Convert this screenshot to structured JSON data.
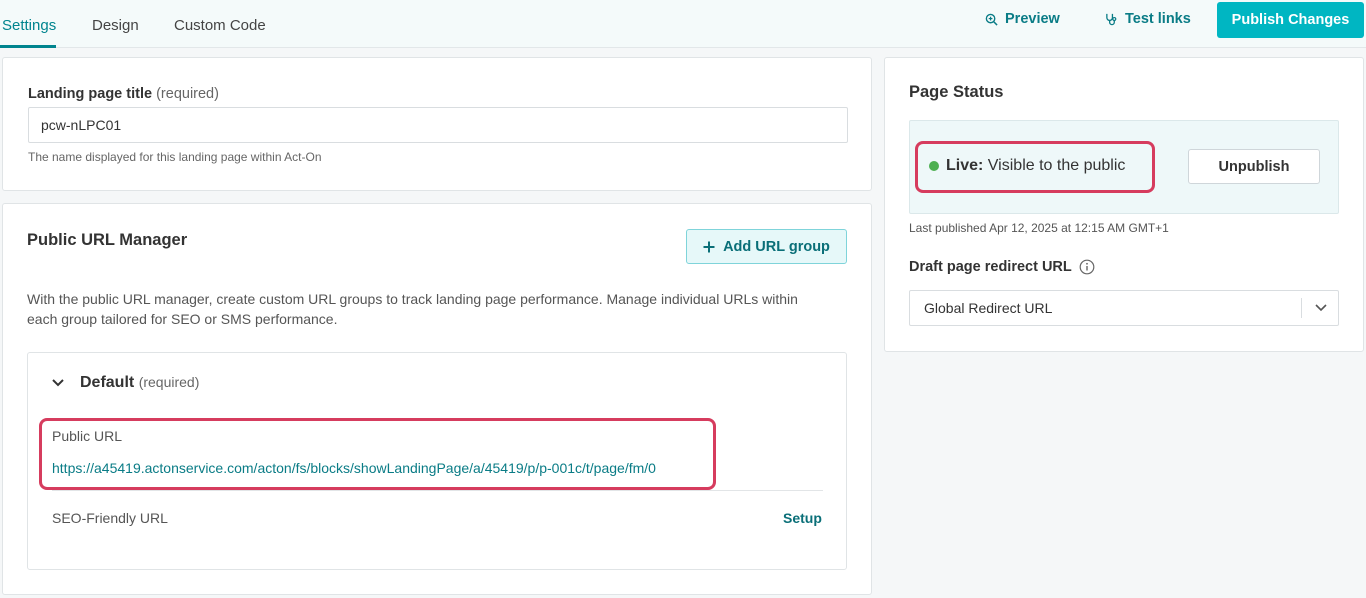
{
  "tabs": [
    {
      "label": "Settings"
    },
    {
      "label": "Design"
    },
    {
      "label": "Custom Code"
    }
  ],
  "toolbar": {
    "preview_label": "Preview",
    "test_links_label": "Test links",
    "publish_label": "Publish Changes"
  },
  "title_card": {
    "label": "Landing page title",
    "required": "(required)",
    "value": "pcw-nLPC01",
    "helper": "The name displayed for this landing page within Act-On"
  },
  "url_manager": {
    "title": "Public URL Manager",
    "add_group_label": "Add URL group",
    "description": "With the public URL manager, create custom URL groups to track landing page performance. Manage individual URLs within each group tailored for SEO or SMS performance.",
    "group": {
      "name": "Default",
      "required": "(required)",
      "public_url_label": "Public URL",
      "public_url": "https://a45419.actonservice.com/acton/fs/blocks/showLandingPage/a/45419/p/p-001c/t/page/fm/0",
      "seo_label": "SEO-Friendly URL",
      "setup_label": "Setup"
    }
  },
  "page_status": {
    "title": "Page Status",
    "status_bold": "Live:",
    "status_text": "Visible to the public",
    "status_color": "#4caf50",
    "unpublish_label": "Unpublish",
    "last_published": "Last published Apr 12, 2025 at 12:15 AM GMT+1",
    "redirect_label": "Draft page redirect URL",
    "redirect_value": "Global Redirect URL"
  }
}
